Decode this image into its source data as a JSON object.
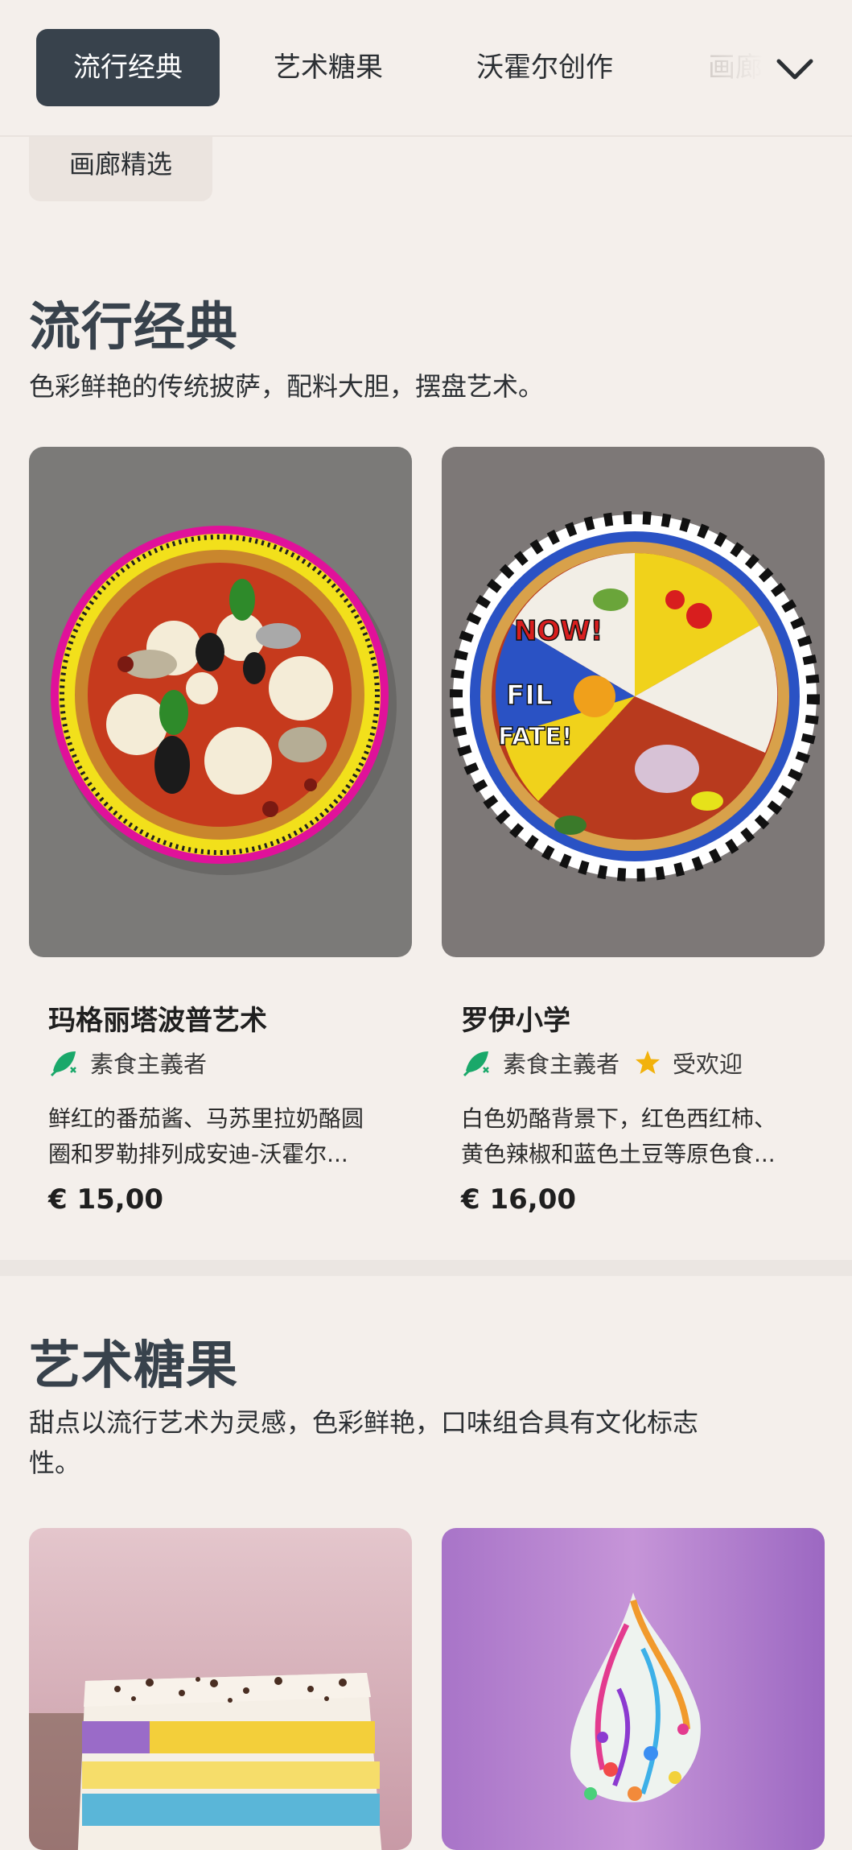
{
  "nav": {
    "tabs": [
      "流行经典",
      "艺术糖果",
      "沃霍尔创作",
      "画廊精选"
    ],
    "active_tab": "流行经典",
    "expand_icon": "chevron-down-icon"
  },
  "sections": [
    {
      "title": "流行经典",
      "description": "色彩鲜艳的传统披萨，配料大胆，摆盘艺术。",
      "items": [
        {
          "name": "玛格丽塔波普艺术",
          "tags": [
            "素食主義者"
          ],
          "description_lines": [
            "鲜红的番茄酱、马苏里拉奶酪圆",
            "圈和罗勒排列成安迪-沃霍尔..."
          ],
          "price": "€ 15,00"
        },
        {
          "name": "罗伊小学",
          "tags": [
            "素食主義者",
            "受欢迎"
          ],
          "description_lines": [
            "白色奶酪背景下，红色西红柿、",
            "黄色辣椒和蓝色土豆等原色食..."
          ],
          "price": "€ 16,00"
        }
      ]
    },
    {
      "title": "艺术糖果",
      "description_lines": [
        "甜点以流行艺术为灵感，色彩鲜艳，口味组合具有文化标志",
        "性。"
      ]
    }
  ],
  "colors": {
    "background": "#f4efeb",
    "active_tab": "#38424c",
    "vegan_icon": "#1aa86a",
    "star": "#f2b20c"
  },
  "icons": {
    "vegan": "vegan-leaf-icon",
    "popular": "star-icon"
  }
}
